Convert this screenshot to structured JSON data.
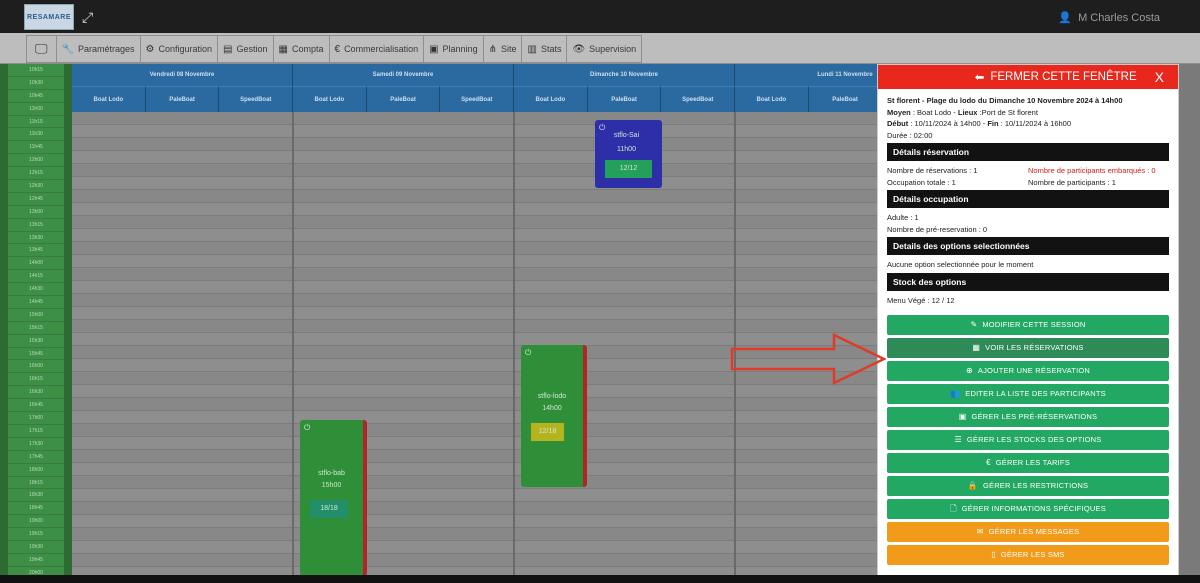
{
  "app": {
    "logo_text": "RESAMARE",
    "user_name": "M Charles Costa"
  },
  "menu": [
    {
      "icon": "monitor-icon",
      "glyph": "🖵",
      "label": ""
    },
    {
      "icon": "wrench-icon",
      "glyph": "🔧",
      "label": "Paramétrages"
    },
    {
      "icon": "cogs-icon",
      "glyph": "⚙",
      "label": "Configuration"
    },
    {
      "icon": "table-icon",
      "glyph": "▤",
      "label": "Gestion"
    },
    {
      "icon": "calculator-icon",
      "glyph": "▦",
      "label": "Compta"
    },
    {
      "icon": "euro-icon",
      "glyph": "€",
      "label": "Commercialisation"
    },
    {
      "icon": "calendar-icon",
      "glyph": "▣",
      "label": "Planning"
    },
    {
      "icon": "sitemap-icon",
      "glyph": "⋔",
      "label": "Site"
    },
    {
      "icon": "chart-icon",
      "glyph": "▥",
      "label": "Stats"
    },
    {
      "icon": "eye-icon",
      "glyph": "👁",
      "label": "Supervision"
    }
  ],
  "calendar": {
    "times": [
      "10h15",
      "10h30",
      "10h45",
      "11h00",
      "11h15",
      "11h30",
      "11h45",
      "12h00",
      "12h15",
      "12h30",
      "12h45",
      "13h00",
      "13h15",
      "13h30",
      "13h45",
      "14h00",
      "14h15",
      "14h30",
      "14h45",
      "15h00",
      "15h15",
      "15h30",
      "15h45",
      "16h00",
      "16h15",
      "16h30",
      "16h45",
      "17h00",
      "17h15",
      "17h30",
      "17h45",
      "18h00",
      "18h15",
      "18h30",
      "18h45",
      "19h00",
      "19h15",
      "19h30",
      "19h45",
      "20h00"
    ],
    "days": [
      {
        "label": "Vendredi 08 Novembre",
        "subs": [
          "Boat Lodo",
          "PaleBoat",
          "SpeedBoat"
        ]
      },
      {
        "label": "Samedi 09 Novembre",
        "subs": [
          "Boat Lodo",
          "PaleBoat",
          "SpeedBoat"
        ]
      },
      {
        "label": "Dimanche 10 Novembre",
        "subs": [
          "Boat Lodo",
          "PaleBoat",
          "SpeedBoat"
        ]
      },
      {
        "label": "Lundi 11 Novembre",
        "subs": [
          "Boat Lodo",
          "PaleBoat"
        ]
      }
    ],
    "events": [
      {
        "name": "stflo-Sai",
        "time": "11h00",
        "count": "12/12",
        "color": "#2d2fa8",
        "stripe": "#2d2fa8",
        "countbg": "#23a05a"
      },
      {
        "name": "stflo-lodo",
        "time": "14h00",
        "count": "12/18",
        "color": "#2f8f38",
        "stripe": "#b02525",
        "countbg": "#b6b41e"
      },
      {
        "name": "stflo-bab",
        "time": "15h00",
        "count": "18/18",
        "color": "#2f8f38",
        "stripe": "#b02525",
        "countbg": "#238f6a"
      }
    ]
  },
  "panel": {
    "close_label": "FERMER CETTE FENÊTRE",
    "close_x": "X",
    "title": "St florent - Plage du lodo du Dimanche 10 Novembre 2024 à 14h00",
    "moyen_label": "Moyen",
    "moyen_value": " : Boat Lodo - ",
    "lieux_label": "Lieux",
    "lieux_value": " :Port de St florent",
    "debut_label": "Début",
    "debut_value": " : 10/11/2024 à 14h00 - ",
    "fin_label": "Fin",
    "fin_value": " : 10/11/2024 à 16h00",
    "duree": "Durée : 02:00",
    "sec_reservation": "Détails réservation",
    "nb_reservations": "Nombre de réservations : 1",
    "nb_embarques": "Nombre de participants embarqués : 0",
    "occupation_totale": "Occupation totale : 1",
    "nb_participants": "Nombre de participants : 1",
    "sec_occupation": "Détails occupation",
    "adulte": "Adulte : 1",
    "nb_prereservation": "Nombre de pré-reservation : 0",
    "sec_options": "Details des options selectionnées",
    "aucune_option": "Aucune option selectionnée pour le moment",
    "sec_stock": "Stock des options",
    "menu_vege": "Menu Végé : 12 / 12",
    "buttons": [
      {
        "label": "MODIFIER CETTE SESSION",
        "icon": "edit-icon",
        "glyph": "✎",
        "style": ""
      },
      {
        "label": "VOIR LES RÉSERVATIONS",
        "icon": "calendar-icon",
        "glyph": "▦",
        "style": "dark"
      },
      {
        "label": "AJOUTER UNE RÉSERVATION",
        "icon": "plus-circle-icon",
        "glyph": "⊕",
        "style": ""
      },
      {
        "label": "EDITER LA LISTE DES PARTICIPANTS",
        "icon": "users-icon",
        "glyph": "👥",
        "style": ""
      },
      {
        "label": "GÉRER LES PRÉ-RÉSERVATIONS",
        "icon": "calendar-check-icon",
        "glyph": "▣",
        "style": ""
      },
      {
        "label": "GÉRER LES STOCKS DES OPTIONS",
        "icon": "list-icon",
        "glyph": "☰",
        "style": ""
      },
      {
        "label": "GÉRER LES TARIFS",
        "icon": "euro-icon",
        "glyph": "€",
        "style": ""
      },
      {
        "label": "GÉRER LES RESTRICTIONS",
        "icon": "lock-icon",
        "glyph": "🔒",
        "style": ""
      },
      {
        "label": "GÉRER INFORMATIONS SPÉCIFIQUES",
        "icon": "file-icon",
        "glyph": "🗋",
        "style": ""
      },
      {
        "label": "GÉRER LES MESSAGES",
        "icon": "envelope-icon",
        "glyph": "✉",
        "style": "orange"
      },
      {
        "label": "GÉRER LES SMS",
        "icon": "mobile-icon",
        "glyph": "▯",
        "style": "orange"
      }
    ]
  },
  "colors": {
    "panel_header": "#e8281c",
    "button_green": "#22a862",
    "button_orange": "#f29a1a",
    "calendar_header": "#2a6aa0",
    "annotation_arrow": "#e03a28"
  }
}
